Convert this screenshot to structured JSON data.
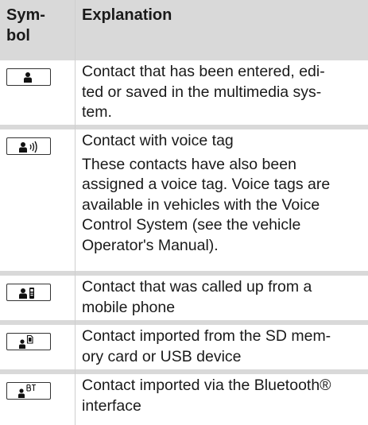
{
  "header": {
    "symbol": "Sym-\nbol",
    "explanation": "Explanation"
  },
  "rows": [
    {
      "icon": "contact-icon",
      "text": [
        "Contact that has been entered, edi-",
        "ted or saved in the multimedia sys-",
        "tem."
      ]
    },
    {
      "icon": "contact-voice-tag-icon",
      "text": [
        "Contact with voice tag"
      ],
      "text2": [
        "These contacts have also been",
        "assigned a voice tag. Voice tags are",
        "available in vehicles with the Voice",
        "Control System (see the vehicle",
        "Operator's Manual)."
      ]
    },
    {
      "icon": "contact-mobile-phone-icon",
      "text": [
        "Contact that was called up from a",
        "mobile phone"
      ]
    },
    {
      "icon": "contact-sd-card-icon",
      "text": [
        "Contact imported from the SD mem-",
        "ory card or USB device"
      ]
    },
    {
      "icon": "contact-bluetooth-icon",
      "text": [
        "Contact imported via the Bluetooth®",
        "interface"
      ]
    }
  ]
}
